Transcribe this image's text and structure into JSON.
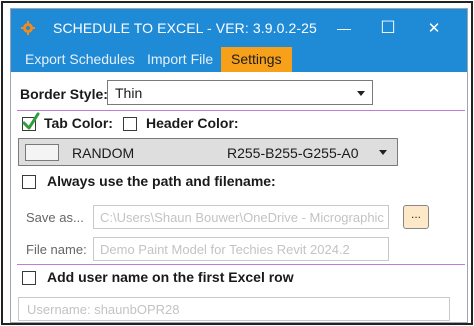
{
  "window": {
    "title": "SCHEDULE TO EXCEL - VER: 3.9.0.2-25",
    "icon": "gear-icon",
    "title_bar_color": "#1f8ad6",
    "minimize_glyph": "—",
    "maximize_glyph": "☐",
    "close_glyph": "✕"
  },
  "tabs": [
    {
      "label": "Export Schedules",
      "active": false
    },
    {
      "label": "Import File",
      "active": false
    },
    {
      "label": "Settings",
      "active": true
    }
  ],
  "active_tab_color": "#f7a11a",
  "settings": {
    "border_style": {
      "label": "Border Style:",
      "value": "Thin"
    },
    "tab_color": {
      "label": "Tab Color:",
      "checked": true
    },
    "header_color": {
      "label": "Header Color:",
      "checked": false
    },
    "color_select": {
      "name": "RANDOM",
      "rgba": "R255-B255-G255-A0",
      "swatch_color": "#f4f4f4"
    },
    "always_use_path": {
      "label": "Always use the path and filename:",
      "checked": false
    },
    "save_as": {
      "label": "Save as...",
      "value": "C:\\Users\\Shaun Bouwer\\OneDrive - Micrographic",
      "browse_label": "..."
    },
    "file_name": {
      "label": "File name:",
      "value": "Demo Paint Model for Techies Revit 2024.2"
    },
    "add_user_name": {
      "label": "Add user name on the first Excel row",
      "checked": false
    },
    "username": {
      "value": "Username: shaunbOPR28"
    }
  },
  "divider_color": "#c47bd4",
  "check_color": "#2e9e3a"
}
